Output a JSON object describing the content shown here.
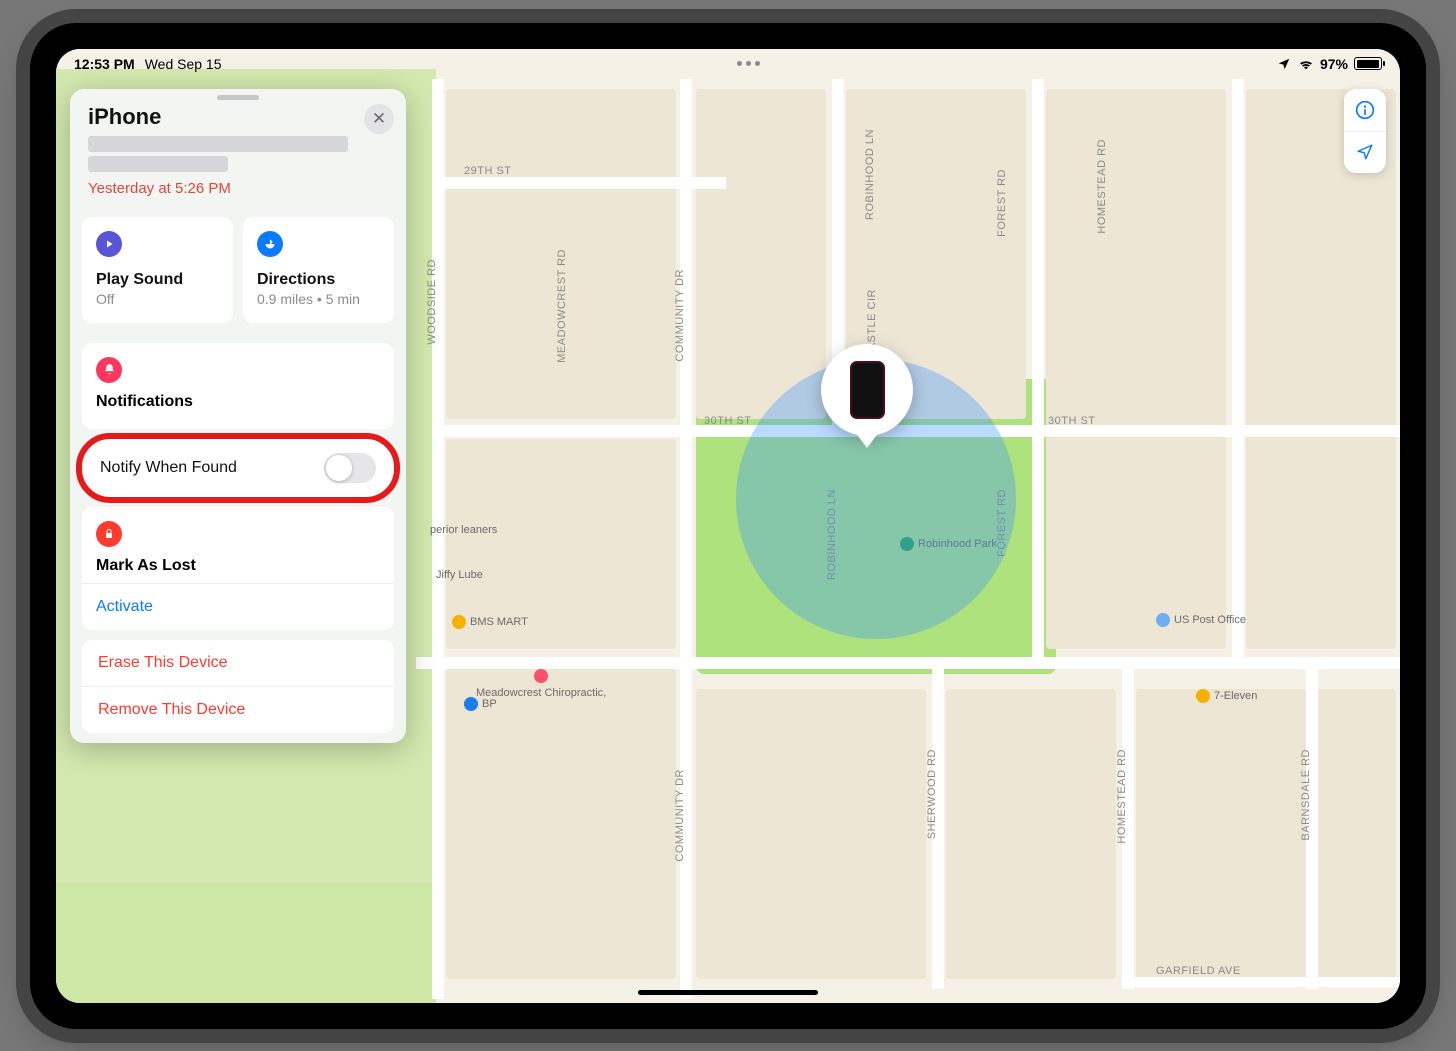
{
  "status": {
    "time": "12:53 PM",
    "date": "Wed Sep 15",
    "battery_pct": "97%"
  },
  "sidebar": {
    "device_name": "iPhone",
    "last_seen": "Yesterday at 5:26 PM",
    "actions": {
      "play_sound": {
        "title": "Play Sound",
        "subtitle": "Off"
      },
      "directions": {
        "title": "Directions",
        "subtitle": "0.9 miles • 5 min"
      }
    },
    "notifications": {
      "header": "Notifications",
      "notify_when_found_label": "Notify When Found"
    },
    "mark_as_lost": {
      "header": "Mark As Lost",
      "activate": "Activate"
    },
    "erase_label": "Erase This Device",
    "remove_label": "Remove This Device"
  },
  "map": {
    "streets": {
      "s29": "29TH ST",
      "s30a": "30TH ST",
      "s30b": "30TH ST",
      "woodside": "WOODSIDE RD",
      "meadowcrest": "MEADOWCREST RD",
      "community": "COMMUNITY DR",
      "community2": "COMMUNITY DR",
      "robinhood": "ROBINHOOD LN",
      "robinhood2": "ROBINHOOD LN",
      "castle": "CASTLE CIR",
      "forest": "FOREST RD",
      "forest2": "FOREST RD",
      "homestead": "HOMESTEAD RD",
      "homestead2": "HOMESTEAD RD",
      "sherwood": "SHERWOOD RD",
      "barnsdale": "BARNSDALE RD",
      "garfield": "GARFIELD AVE"
    },
    "poi": {
      "robinhood_park": "Robinhood Park",
      "us_post": "US Post Office",
      "seven11": "7-Eleven",
      "bp": "BP",
      "bms": "BMS MART",
      "jiffy": "Jiffy Lube",
      "cleaners": "perior leaners",
      "meadowcrest_chiro": "Meadowcrest Chiropractic,"
    }
  }
}
